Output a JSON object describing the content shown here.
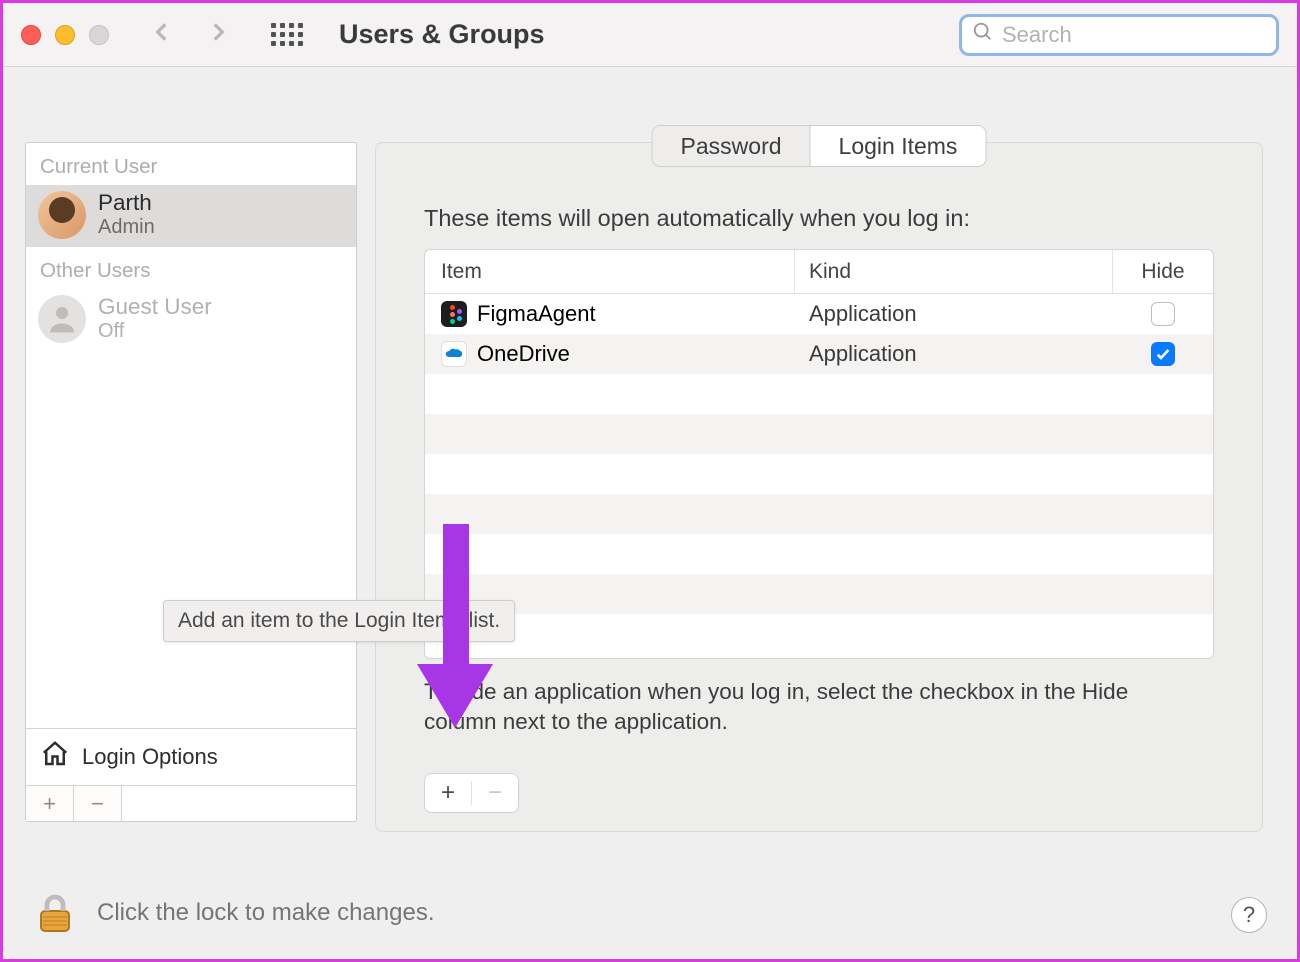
{
  "window": {
    "title": "Users & Groups",
    "search_placeholder": "Search"
  },
  "sidebar": {
    "current_user_label": "Current User",
    "other_users_label": "Other Users",
    "current_user": {
      "name": "Parth",
      "role": "Admin"
    },
    "other_users": [
      {
        "name": "Guest User",
        "role": "Off"
      }
    ],
    "login_options_label": "Login Options"
  },
  "tabs": {
    "password": "Password",
    "login_items": "Login Items",
    "active": "login_items"
  },
  "main": {
    "intro": "These items will open automatically when you log in:",
    "columns": {
      "item": "Item",
      "kind": "Kind",
      "hide": "Hide"
    },
    "rows": [
      {
        "icon": "figma",
        "name": "FigmaAgent",
        "kind": "Application",
        "hide": false
      },
      {
        "icon": "onedrive",
        "name": "OneDrive",
        "kind": "Application",
        "hide": true
      }
    ],
    "hint": "To hide an application when you log in, select the checkbox in the Hide column next to the application."
  },
  "tooltip": "Add an item to the Login Items list.",
  "lock_text": "Click the lock to make changes.",
  "help": "?"
}
